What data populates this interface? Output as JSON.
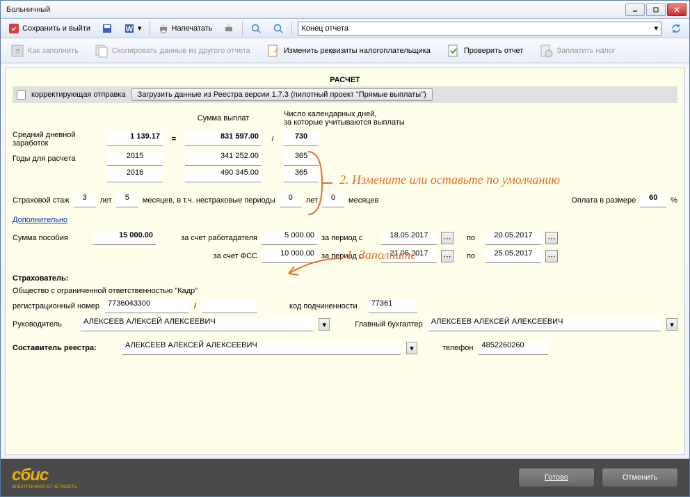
{
  "window": {
    "title": "Больничный"
  },
  "toolbar": {
    "save_exit": "Сохранить и выйти",
    "print": "Напечатать",
    "combo": "Конец отчета"
  },
  "toolbar2": {
    "how_fill": "Как заполнить",
    "copy_data": "Скопировать данные из другого отчета",
    "change_req": "Изменить реквизиты налогоплательщика",
    "check_report": "Проверить отчет",
    "pay_tax": "Заплатить налог"
  },
  "panel": {
    "header": "РАСЧЕТ",
    "corr_label": "корректирующая отправка",
    "load_btn": "Загрузить данные из Реестра версии 1.7.3 (пилотный проект \"Прямые выплаты\")",
    "col_sum": "Сумма выплат",
    "col_days": "Число календарных дней,\nза которые учитываются выплаты",
    "avg_label": "Средний дневной заработок",
    "avg_value": "1 139.17",
    "eq": "=",
    "slash": "/",
    "total_sum": "831 597.00",
    "total_days": "730",
    "years_label": "Годы для расчета",
    "year1": "2015",
    "sum1": "341 252.00",
    "days1": "365",
    "year2": "2016",
    "sum2": "490 345.00",
    "days2": "365",
    "stazh_label": "Страховой стаж",
    "years_n": "3",
    "years_word": "лет",
    "months_n": "5",
    "months_word": "месяцев, в т.ч. нестраховые периоды",
    "ns_years": "0",
    "ns_years_word": "лет",
    "ns_months": "0",
    "ns_months_word": "месяцев",
    "pay_pct_label": "Оплата в размере",
    "pay_pct": "60",
    "pct": "%",
    "link": "Дополнительно",
    "benefit_label": "Сумма пособия",
    "benefit_total": "15 000.00",
    "by_employer": "за счет работадателя",
    "employer_sum": "5 000.00",
    "by_fss": "за счет ФСС",
    "fss_sum": "10 000.00",
    "period_from": "за период с",
    "period_to": "по",
    "date1": "18.05.2017",
    "date2": "20.05.2017",
    "date3": "21.05.2017",
    "date4": "25.05.2017",
    "insurer_label": "Страхователь:",
    "insurer_name": "Общество с ограниченной ответственностью \"Кадр\"",
    "reg_label": "регистрационный номер",
    "reg_num": "7736043300",
    "sub_label": "код подчиненности",
    "sub_code": "77361",
    "head_label": "Руководитель",
    "head_name": "АЛЕКСЕЕВ АЛЕКСЕЙ АЛЕКСЕЕВИЧ",
    "acc_label": "Главный бухгалтер",
    "acc_name": "АЛЕКСЕЕВ АЛЕКСЕЙ АЛЕКСЕЕВИЧ",
    "compiler_label": "Составитель реестра:",
    "compiler_name": "АЛЕКСЕЕВ АЛЕКСЕЙ АЛЕКСЕЕВИЧ",
    "phone_label": "телефон",
    "phone": "4852260260"
  },
  "annot": {
    "a1": "1. Заполните",
    "a2": "2. Измените или оставьте по умолчанию"
  },
  "footer": {
    "logo": "сбис",
    "logo_sub": "ЭЛЕКТРОННАЯ ОТЧЕТНОСТЬ",
    "ready": "Готово",
    "cancel": "Отменить"
  }
}
